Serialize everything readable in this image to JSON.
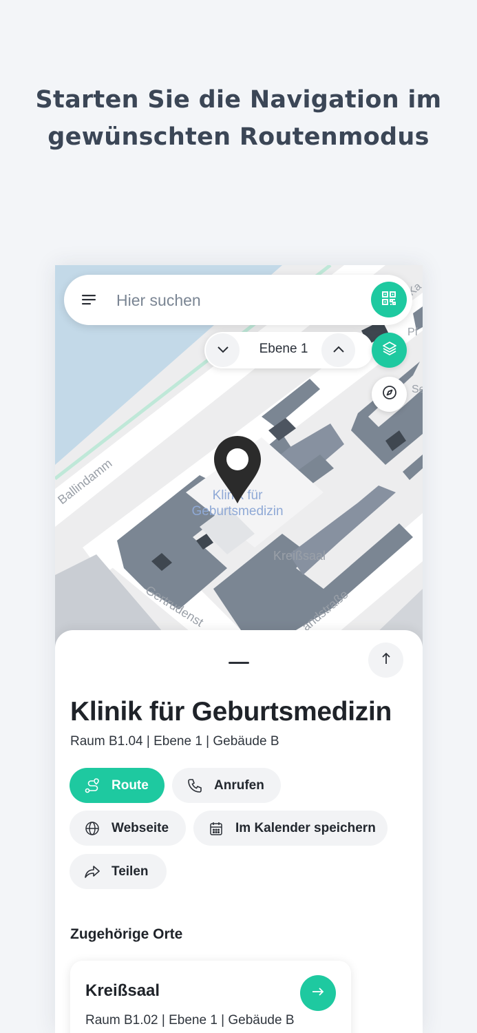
{
  "headline": {
    "line1": "Starten Sie die Navigation im",
    "line2": "gewünschten Routenmodus"
  },
  "search": {
    "placeholder": "Hier suchen",
    "menu_icon": "hamburger-menu-icon",
    "qr_icon": "qr-code-icon"
  },
  "floor": {
    "label": "Ebene 1",
    "down_icon": "chevron-down-icon",
    "up_icon": "chevron-up-icon"
  },
  "map": {
    "streets": [
      "Ballindamm",
      "Gertrudenst",
      "andstraße"
    ],
    "labels": {
      "poi": "Klinik für Geburtsmedizin",
      "room": "Kreißsaal",
      "edge": [
        "Pf",
        "Se",
        "Ka"
      ]
    },
    "colors": {
      "water": "#c3d9e8",
      "ground": "#ededee",
      "road": "#ffffff",
      "building": "#7b8693",
      "accent": "#1ec9a0"
    }
  },
  "place": {
    "title": "Klinik für Geburtsmedizin",
    "subtitle": "Raum B1.04 | Ebene 1 | Gebäude B",
    "actions": {
      "route": "Route",
      "call": "Anrufen",
      "website": "Webseite",
      "calendar": "Im Kalender speichern",
      "share": "Teilen"
    }
  },
  "related": {
    "title": "Zugehörige Orte",
    "items": [
      {
        "title": "Kreißsaal",
        "subtitle": "Raum B1.02 | Ebene 1 | Gebäude B"
      }
    ]
  }
}
